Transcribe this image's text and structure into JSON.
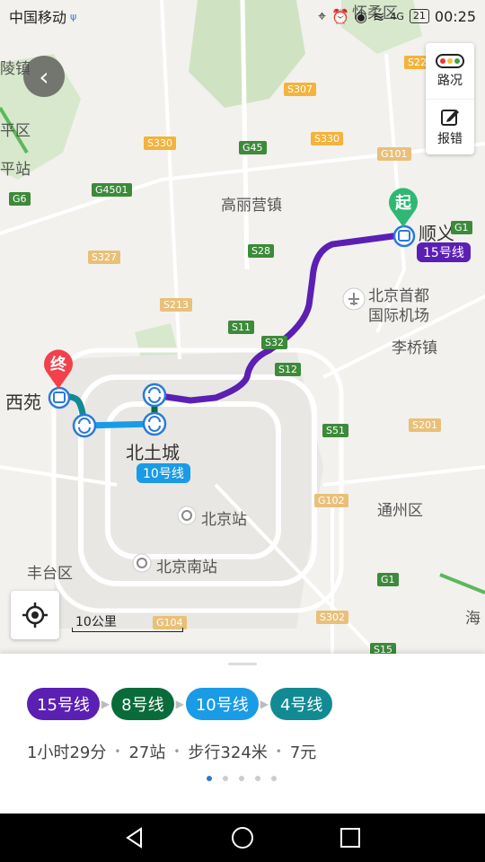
{
  "status_bar": {
    "carrier": "中国移动",
    "sim_badge": "ψ",
    "network": "4G",
    "battery": "21",
    "time": "00:25"
  },
  "map": {
    "labels": {
      "gaoliying": "高丽营镇",
      "shunyi": "顺义",
      "airport_line1": "北京首都",
      "airport_line2": "国际机场",
      "liqiao": "李桥镇",
      "xiyuan": "西苑",
      "beitucheng": "北土城",
      "beijing_station": "北京站",
      "beijing_south": "北京南站",
      "tongzhou": "通州区",
      "fengtai": "丰台区",
      "changping": "平区",
      "pingzhan": "平站",
      "lingzhen": "陵镇",
      "huairou": "怀柔区",
      "haidian": "海"
    },
    "shields": {
      "s307": "S307",
      "s330a": "S330",
      "s330b": "S330",
      "g45": "G45",
      "g101": "G101",
      "g4501": "G4501",
      "g6": "G6",
      "s327": "S327",
      "s28": "S28",
      "s213": "S213",
      "s11": "S11",
      "s32": "S32",
      "s12": "S12",
      "s51": "S51",
      "s201": "S201",
      "g102": "G102",
      "g1": "G1",
      "s302": "S302",
      "g104": "G104",
      "s15": "S15",
      "s22": "S22",
      "g1b": "G1"
    },
    "start_marker": "起",
    "end_marker": "终",
    "line15_tag": "15号线",
    "line10_tag": "10号线",
    "scale": "10公里",
    "traffic_button": "路况",
    "report_button": "报错"
  },
  "route": {
    "lines": [
      {
        "label": "15号线",
        "color": "#5b1fb4"
      },
      {
        "label": "8号线",
        "color": "#0a6b3a"
      },
      {
        "label": "10号线",
        "color": "#1a9be6"
      },
      {
        "label": "4号线",
        "color": "#118a93"
      }
    ],
    "duration": "1小时29分",
    "stations": "27站",
    "walk": "步行324米",
    "fare": "7元",
    "page_count": 5,
    "active_page": 1
  },
  "nav": {
    "back": "back-icon",
    "home": "home-icon",
    "recents": "recents-icon"
  }
}
